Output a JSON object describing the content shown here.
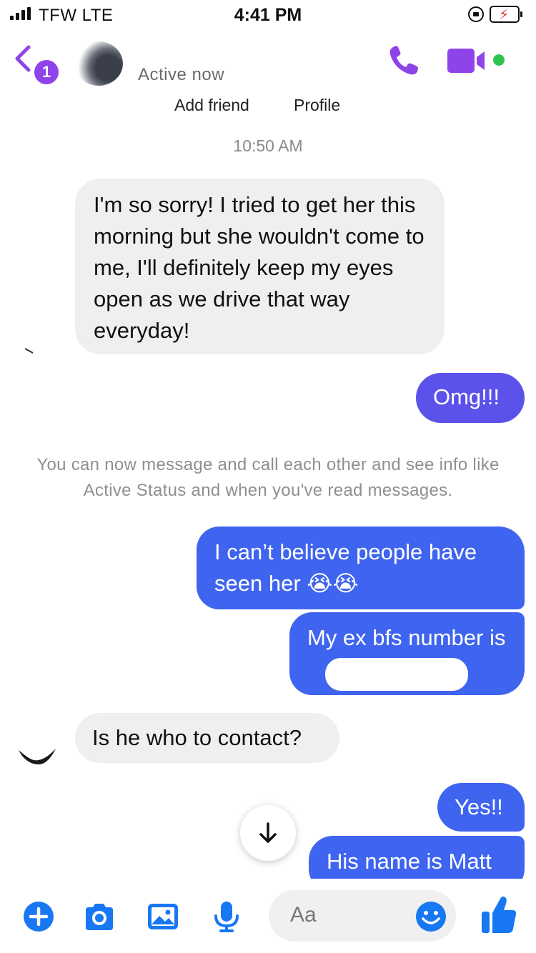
{
  "status_bar": {
    "carrier": "TFW  LTE",
    "time": "4:41 PM"
  },
  "header": {
    "unread_count": "1",
    "status": "Active now",
    "add_friend": "Add friend",
    "profile": "Profile"
  },
  "conversation": {
    "timestamp": "10:50 AM",
    "messages": [
      {
        "from": "them",
        "text": "I'm so sorry! I tried to get her this morning but she wouldn't come to me, I'll definitely keep my eyes open as we drive that way everyday!"
      },
      {
        "from": "me",
        "text": "Omg!!!"
      },
      {
        "from": "me",
        "text": "I can’t believe people have seen her 😭😭"
      },
      {
        "from": "me",
        "text": "My ex bfs number is"
      },
      {
        "from": "them",
        "text": "Is he who to contact?"
      },
      {
        "from": "me",
        "text": "Yes!!"
      },
      {
        "from": "me",
        "text": "His name is Matt"
      }
    ],
    "system_note": "You can now message and call each other and see info like Active Status and when you've read messages."
  },
  "composer": {
    "placeholder": "Aa"
  },
  "colors": {
    "outgoing_bubble": "#3e64f0",
    "incoming_bubble": "#efefef",
    "messenger_blue": "#1877f2",
    "header_purple": "#8e44e8",
    "online_green": "#31c24d"
  },
  "icons": [
    "back-chevron-icon",
    "phone-icon",
    "video-camera-icon",
    "arrow-down-icon",
    "plus-icon",
    "camera-icon",
    "gallery-icon",
    "microphone-icon",
    "emoji-icon",
    "thumbs-up-icon"
  ]
}
